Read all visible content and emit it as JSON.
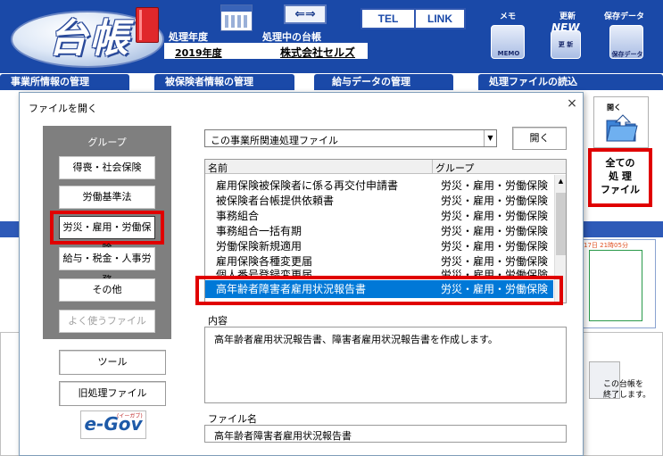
{
  "header": {
    "logo_text": "台帳",
    "year_label": "処理年度",
    "year_value": "2019年度",
    "ledger_label": "処理中の台帳",
    "company_name": "株式会社セルズ",
    "tel_button": "TEL",
    "link_button": "LINK",
    "swap_glyph": "⇐⇒",
    "memo_label": "メモ",
    "memo_caption": "MEMO",
    "update_label": "更新",
    "update_badge": "NEW",
    "update_caption": "更 新",
    "save_label": "保存データ",
    "save_caption": "保存データ"
  },
  "tabs": [
    {
      "label": "事業所情報の管理"
    },
    {
      "label": "被保険者情報の管理"
    },
    {
      "label": "給与データの管理"
    },
    {
      "label": "処理ファイルの読込"
    }
  ],
  "side": {
    "open_caption": "開く",
    "all_files": [
      "全ての",
      "処 理",
      "ファイル"
    ],
    "end_text": [
      "この台帳を",
      "終了します。"
    ],
    "timestamp": "17日 21時05分"
  },
  "dialog": {
    "title": "ファイルを開く",
    "close": "×",
    "group_title": "グループ",
    "groups": [
      {
        "label": "得喪・社会保険"
      },
      {
        "label": "労働基準法"
      },
      {
        "label": "労災・雇用・労働保険"
      },
      {
        "label": "給与・税金・人事労務"
      },
      {
        "label": "その他"
      },
      {
        "label": "よく使うファイル"
      }
    ],
    "tools_button": "ツール",
    "old_files_button": "旧処理ファイル",
    "egov_logo": "e-Gov",
    "egov_small": "(イーガブ)",
    "combo_value": "この事業所関連処理ファイル",
    "combo_arrow": "▼",
    "open_button": "開く",
    "col_name": "名前",
    "col_group": "グループ",
    "scroll_up": "▲",
    "rows": [
      {
        "name": "雇用保険被保険者に係る再交付申請書",
        "group": "労災・雇用・労働保険"
      },
      {
        "name": "被保険者台帳提供依頼書",
        "group": "労災・雇用・労働保険"
      },
      {
        "name": "事務組合",
        "group": "労災・雇用・労働保険"
      },
      {
        "name": "事務組合一括有期",
        "group": "労災・雇用・労働保険"
      },
      {
        "name": "労働保険新規適用",
        "group": "労災・雇用・労働保険"
      },
      {
        "name": "雇用保険各種変更届",
        "group": "労災・雇用・労働保険"
      },
      {
        "name": "個人番号登録変更届",
        "group": "労災・雇用・労働保険"
      },
      {
        "name": "高年齢者障害者雇用状況報告書",
        "group": "労災・雇用・労働保険"
      }
    ],
    "content_label": "内容",
    "content_text": "高年齢者雇用状況報告書、障害者雇用状況報告書を作成します。",
    "filename_label": "ファイル名",
    "filename_value": "高年齢者障害者雇用状況報告書"
  },
  "colors": {
    "brand_blue": "#1a49a8",
    "highlight_red": "#e00000",
    "selection_blue": "#0078d7"
  }
}
